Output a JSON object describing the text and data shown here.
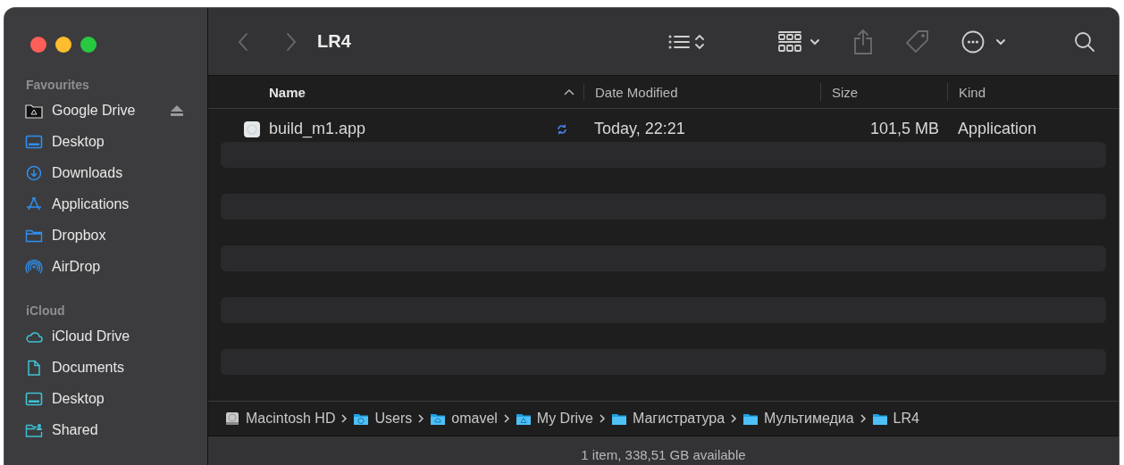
{
  "window": {
    "title": "LR4"
  },
  "sidebar": {
    "sections": [
      {
        "title": "Favourites",
        "items": [
          {
            "label": "Google Drive",
            "kind": "drive",
            "ejectable": true
          },
          {
            "label": "Desktop",
            "kind": "desktop",
            "ejectable": false
          },
          {
            "label": "Downloads",
            "kind": "downloads",
            "ejectable": false
          },
          {
            "label": "Applications",
            "kind": "apps",
            "ejectable": false
          },
          {
            "label": "Dropbox",
            "kind": "folder",
            "ejectable": false
          },
          {
            "label": "AirDrop",
            "kind": "airdrop",
            "ejectable": false
          }
        ]
      },
      {
        "title": "iCloud",
        "items": [
          {
            "label": "iCloud Drive",
            "kind": "cloud",
            "ejectable": false
          },
          {
            "label": "Documents",
            "kind": "document",
            "ejectable": false
          },
          {
            "label": "Desktop",
            "kind": "desktop",
            "ejectable": false
          },
          {
            "label": "Shared",
            "kind": "shared",
            "ejectable": false
          }
        ]
      }
    ]
  },
  "table": {
    "columns": [
      {
        "label": "Name",
        "sorted": true
      },
      {
        "label": "Date Modified",
        "sorted": false
      },
      {
        "label": "Size",
        "sorted": false
      },
      {
        "label": "Kind",
        "sorted": false
      }
    ],
    "rows": [
      {
        "name": "build_m1.app",
        "syncing": true,
        "date": "Today, 22:21",
        "size": "101,5 MB",
        "kind": "Application"
      }
    ]
  },
  "path_bar": [
    {
      "label": "Macintosh HD",
      "kind": "disk"
    },
    {
      "label": "Users",
      "kind": "users"
    },
    {
      "label": "omavel",
      "kind": "home"
    },
    {
      "label": "My Drive",
      "kind": "drive"
    },
    {
      "label": "Магистратура",
      "kind": "folder"
    },
    {
      "label": "Мультимедиа",
      "kind": "folder"
    },
    {
      "label": "LR4",
      "kind": "folder"
    }
  ],
  "status_bar": "1 item, 338,51 GB available"
}
